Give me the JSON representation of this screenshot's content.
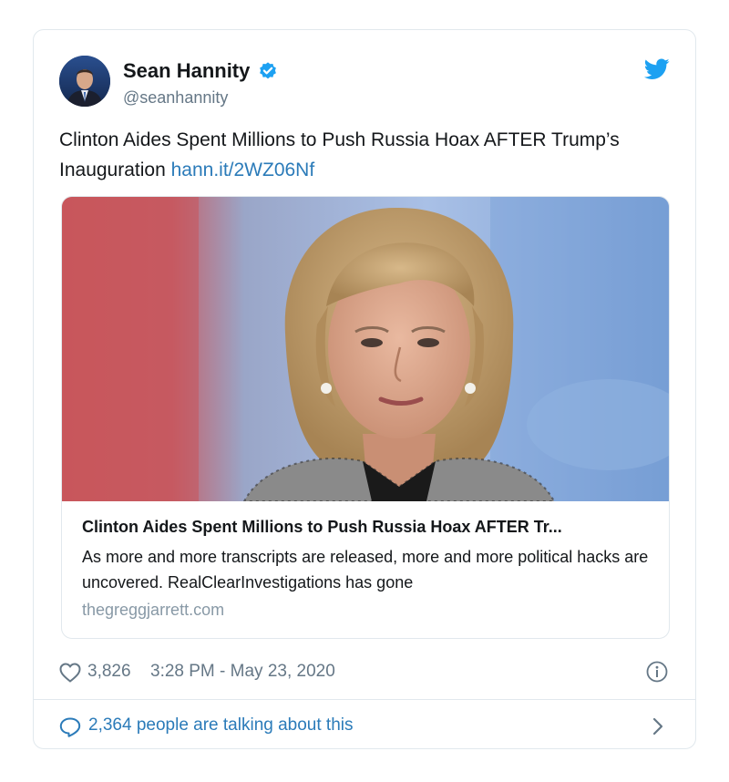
{
  "author": {
    "display_name": "Sean Hannity",
    "handle": "@seanhannity",
    "verified": true
  },
  "tweet": {
    "text": "Clinton Aides Spent Millions to Push Russia Hoax AFTER Trump’s Inauguration",
    "link_text": "hann.it/2WZ06Nf"
  },
  "link_card": {
    "title": "Clinton Aides Spent Millions to Push Russia Hoax AFTER Tr...",
    "description": "As more and more transcripts are released, more and more political hacks are uncovered. RealClearInvestigations has gone",
    "domain": "thegreggjarrett.com"
  },
  "meta": {
    "likes": "3,826",
    "timestamp": "3:28 PM - May 23, 2020"
  },
  "conversation": {
    "label": "2,364 people are talking about this"
  },
  "colors": {
    "accent": "#1da1f2",
    "link": "#2b7bb9",
    "muted": "#657786",
    "border": "#e1e8ed"
  },
  "icons": [
    "verified-badge-icon",
    "twitter-bird-icon",
    "heart-icon",
    "info-icon",
    "speech-bubble-icon",
    "chevron-right-icon"
  ]
}
